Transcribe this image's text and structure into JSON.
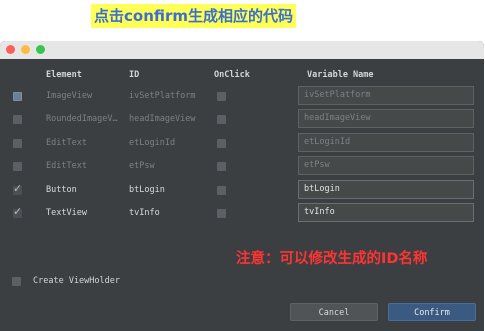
{
  "caption": "点击confirm生成相应的代码",
  "headers": {
    "element": "Element",
    "id": "ID",
    "onclick": "OnClick",
    "variable": "Variable Name"
  },
  "rows": [
    {
      "checked": false,
      "selected": true,
      "element": "ImageView",
      "id": "ivSetPlatform",
      "onclick": false,
      "variable": "ivSetPlatform",
      "enabled": false
    },
    {
      "checked": false,
      "selected": false,
      "element": "RoundedImageV…",
      "id": "headImageView",
      "onclick": false,
      "variable": "headImageView",
      "enabled": false
    },
    {
      "checked": false,
      "selected": false,
      "element": "EditText",
      "id": "etLoginId",
      "onclick": false,
      "variable": "etLoginId",
      "enabled": false
    },
    {
      "checked": false,
      "selected": false,
      "element": "EditText",
      "id": "etPsw",
      "onclick": false,
      "variable": "etPsw",
      "enabled": false
    },
    {
      "checked": true,
      "selected": false,
      "element": "Button",
      "id": "btLogin",
      "onclick": false,
      "variable": "btLogin",
      "enabled": true
    },
    {
      "checked": true,
      "selected": false,
      "element": "TextView",
      "id": "tvInfo",
      "onclick": false,
      "variable": "tvInfo",
      "enabled": true
    }
  ],
  "note": "注意：可以修改生成的ID名称",
  "create_viewholder": {
    "label": "Create ViewHolder",
    "checked": false
  },
  "buttons": {
    "cancel": "Cancel",
    "confirm": "Confirm"
  }
}
